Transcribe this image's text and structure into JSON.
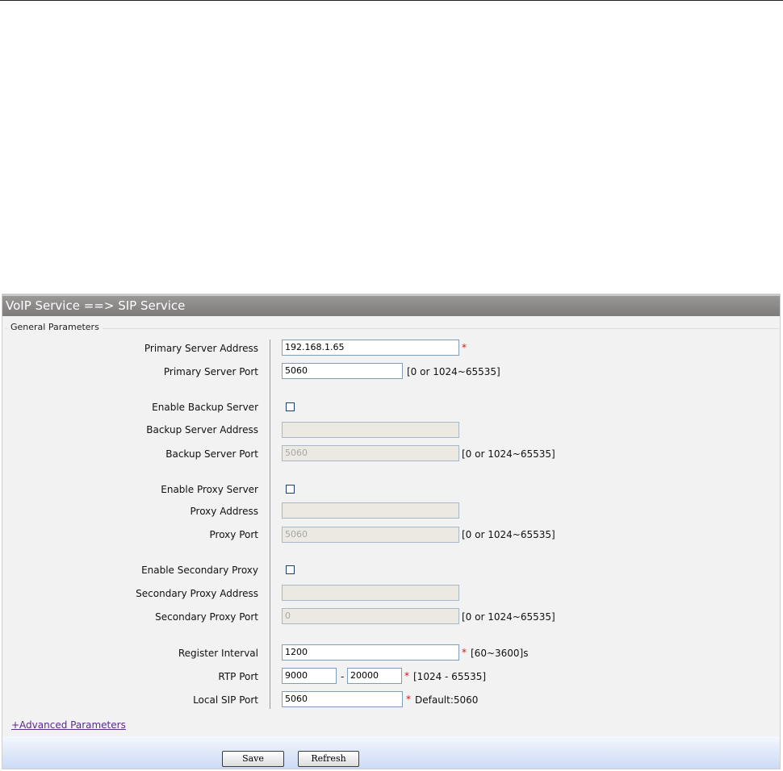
{
  "header": {
    "title": "VoIP Service ==> SIP Service"
  },
  "group": {
    "legend": "General Parameters"
  },
  "labels": {
    "primary_server_address": "Primary Server Address",
    "primary_server_port": "Primary Server Port",
    "enable_backup_server": "Enable Backup Server",
    "backup_server_address": "Backup Server Address",
    "backup_server_port": "Backup Server Port",
    "enable_proxy_server": "Enable Proxy Server",
    "proxy_address": "Proxy Address",
    "proxy_port": "Proxy Port",
    "enable_secondary_proxy": "Enable Secondary Proxy",
    "secondary_proxy_address": "Secondary Proxy Address",
    "secondary_proxy_port": "Secondary Proxy Port",
    "register_interval": "Register Interval",
    "rtp_port": "RTP Port",
    "local_sip_port": "Local SIP Port"
  },
  "values": {
    "primary_server_address": "192.168.1.65",
    "primary_server_port": "5060",
    "backup_server_address": "",
    "backup_server_port": "5060",
    "proxy_address": "",
    "proxy_port": "5060",
    "secondary_proxy_address": "",
    "secondary_proxy_port": "0",
    "register_interval": "1200",
    "rtp_port_start": "9000",
    "rtp_port_end": "20000",
    "local_sip_port": "5060"
  },
  "checkboxes": {
    "enable_backup_server": false,
    "enable_proxy_server": false,
    "enable_secondary_proxy": false
  },
  "hints": {
    "required_mark": "*",
    "port_range": "[0 or 1024~65535]",
    "register_interval_range": "[60~3600]s",
    "rtp_range_separator": "-",
    "rtp_port_range": "[1024 - 65535]",
    "local_sip_default": "Default:5060"
  },
  "links": {
    "advanced": "+Advanced Parameters"
  },
  "buttons": {
    "save": "Save",
    "refresh": "Refresh"
  }
}
